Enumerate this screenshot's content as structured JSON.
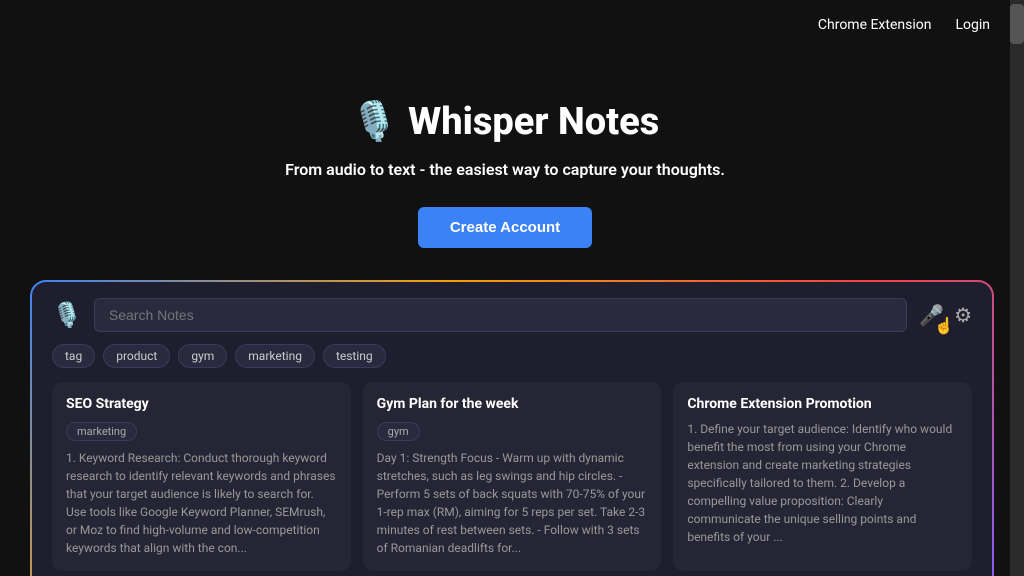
{
  "nav": {
    "chrome_extension": "Chrome Extension",
    "login": "Login"
  },
  "hero": {
    "icon": "🎙️",
    "title": "Whisper Notes",
    "subtitle": "From audio to text - the easiest way to capture your thoughts.",
    "create_account": "Create Account"
  },
  "app": {
    "search_placeholder": "Search Notes",
    "search_value": "",
    "tags": [
      "tag",
      "product",
      "gym",
      "marketing",
      "testing"
    ],
    "notes": [
      {
        "title": "SEO Strategy",
        "tag": "marketing",
        "content": "1. Keyword Research: Conduct thorough keyword research to identify relevant keywords and phrases that your target audience is likely to search for. Use tools like Google Keyword Planner, SEMrush, or Moz to find high-volume and low-competition keywords that align with the con..."
      },
      {
        "title": "Gym Plan for the week",
        "tag": "gym",
        "content": "Day 1: Strength Focus - Warm up with dynamic stretches, such as leg swings and hip circles. - Perform 5 sets of back squats with 70-75% of your 1-rep max (RM), aiming for 5 reps per set. Take 2-3 minutes of rest between sets. - Follow with 3 sets of Romanian deadlifts for..."
      },
      {
        "title": "Chrome Extension Promotion",
        "tag": "",
        "content": "1. Define your target audience: Identify who would benefit the most from using your Chrome extension and create marketing strategies specifically tailored to them. 2. Develop a compelling value proposition: Clearly communicate the unique selling points and benefits of your ..."
      }
    ]
  }
}
